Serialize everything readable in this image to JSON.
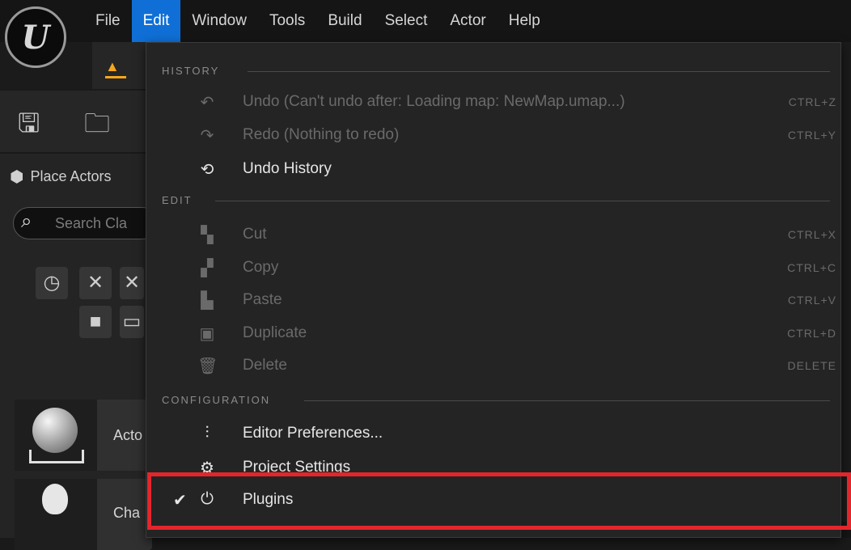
{
  "menubar": {
    "items": [
      "File",
      "Edit",
      "Window",
      "Tools",
      "Build",
      "Select",
      "Actor",
      "Help"
    ],
    "active": "Edit"
  },
  "left_panel": {
    "place_actors_title": "Place Actors",
    "search_placeholder": "Search Cla",
    "assets": [
      {
        "label": "Acto"
      },
      {
        "label": "Cha"
      }
    ]
  },
  "edit_menu": {
    "sections": [
      {
        "title": "HISTORY",
        "items": [
          {
            "label": "Undo (Can't undo after: Loading map: NewMap.umap...)",
            "shortcut": "CTRL+Z",
            "icon": "undo-icon",
            "enabled": false
          },
          {
            "label": "Redo (Nothing to redo)",
            "shortcut": "CTRL+Y",
            "icon": "redo-icon",
            "enabled": false
          },
          {
            "label": "Undo History",
            "shortcut": "",
            "icon": "undo-history-icon",
            "enabled": true
          }
        ]
      },
      {
        "title": "EDIT",
        "items": [
          {
            "label": "Cut",
            "shortcut": "CTRL+X",
            "icon": "cut-icon",
            "enabled": false
          },
          {
            "label": "Copy",
            "shortcut": "CTRL+C",
            "icon": "copy-icon",
            "enabled": false
          },
          {
            "label": "Paste",
            "shortcut": "CTRL+V",
            "icon": "paste-icon",
            "enabled": false
          },
          {
            "label": "Duplicate",
            "shortcut": "CTRL+D",
            "icon": "duplicate-icon",
            "enabled": false
          },
          {
            "label": "Delete",
            "shortcut": "DELETE",
            "icon": "trash-icon",
            "enabled": false
          }
        ]
      },
      {
        "title": "CONFIGURATION",
        "items": [
          {
            "label": "Editor Preferences...",
            "shortcut": "",
            "icon": "sliders-icon",
            "enabled": true
          },
          {
            "label": "Project Settings",
            "shortcut": "",
            "icon": "settings-icon",
            "enabled": true
          },
          {
            "label": "Plugins",
            "shortcut": "",
            "icon": "plug-icon",
            "enabled": true,
            "checked": true
          }
        ]
      }
    ]
  },
  "colors": {
    "accent": "#0f6fd6",
    "highlight": "#e3262c",
    "level": "#f4a81e"
  }
}
